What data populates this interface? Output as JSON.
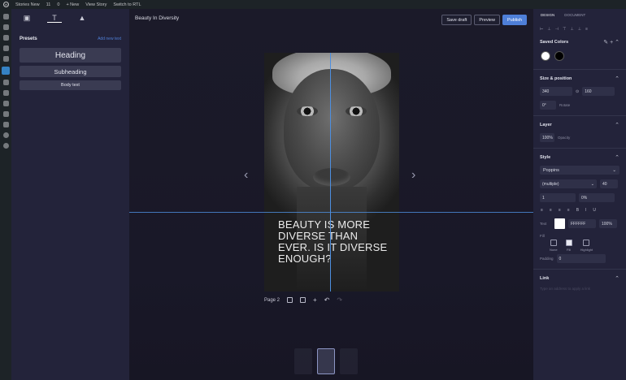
{
  "admin_bar": {
    "site_name": "Stories New",
    "comments": "11",
    "updates": "0",
    "new_label": "+ New",
    "view_story": "View Story",
    "switch_rtl": "Switch to RTL"
  },
  "library": {
    "presets_title": "Presets",
    "add_new_link": "Add new text",
    "presets": [
      "Heading",
      "Subheading",
      "Body text"
    ]
  },
  "header": {
    "story_title": "Beauty In Diversity",
    "save_draft": "Save draft",
    "preview": "Preview",
    "publish": "Publish"
  },
  "canvas": {
    "story_text": "BEAUTY IS MORE DIVERSE THAN EVER. IS IT DIVERSE ENOUGH?",
    "page_label": "Page 2"
  },
  "design_panel": {
    "tabs": [
      "DESIGN",
      "DOCUMENT"
    ],
    "saved_colors_title": "Saved Colors",
    "saved_colors": [
      "#ffffff",
      "#000000"
    ],
    "size_position_title": "Size & position",
    "width": "340",
    "height": "160",
    "rotation": "0°",
    "rotate_label": "Rotate",
    "layer_title": "Layer",
    "opacity_value": "100%",
    "opacity_label": "Opacity",
    "style_title": "Style",
    "font_family": "Poppins",
    "font_weight": "(multiple)",
    "font_size": "40",
    "line_height": "1",
    "letter_spacing": "0%",
    "text_label": "Text",
    "text_color": "FFFFFF",
    "text_opacity": "100%",
    "fill_label": "Fill",
    "fill_options": [
      "None",
      "Fill",
      "Highlight"
    ],
    "padding_label": "Padding",
    "padding_value": "0",
    "link_title": "Link",
    "link_hint": "Type an address to apply a link"
  },
  "accent_color": "#4e7fd8"
}
